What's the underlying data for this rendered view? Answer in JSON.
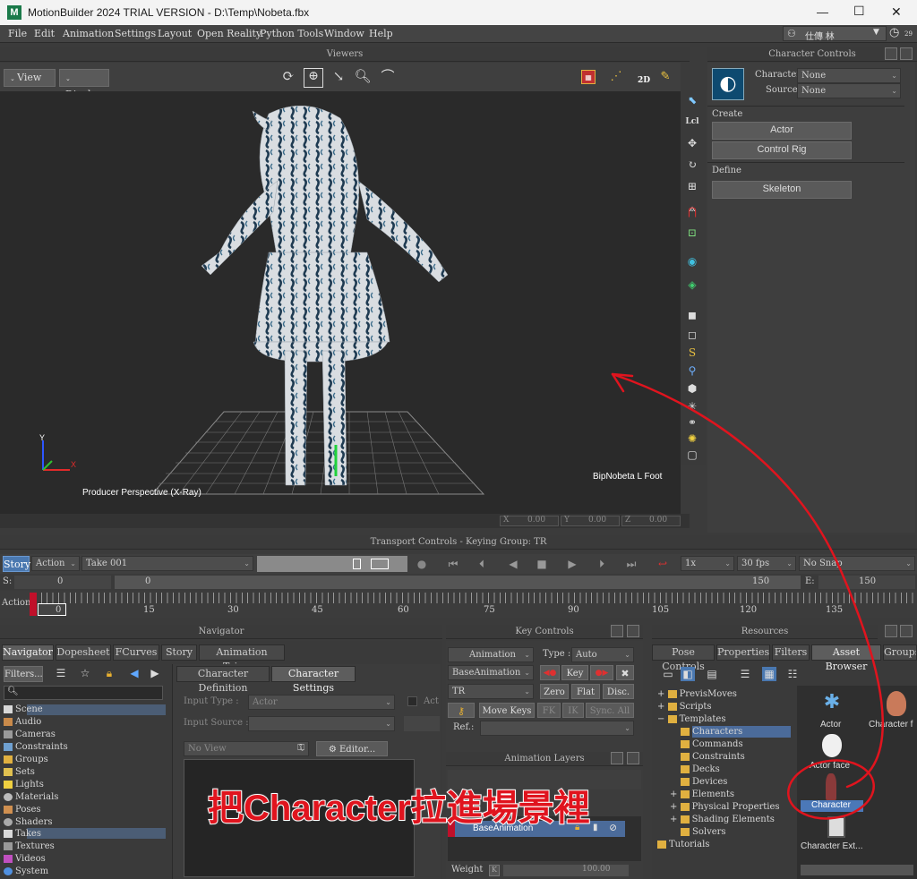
{
  "window": {
    "title": "MotionBuilder 2024 TRIAL VERSION - D:\\Temp\\Nobeta.fbx",
    "minimize": "—",
    "maximize": "☐",
    "close": "✕",
    "user": "仕傳 林",
    "clock_badge": "29"
  },
  "menu": [
    "File",
    "Edit",
    "Animation",
    "Settings",
    "Layout",
    "Open Reality",
    "Python Tools",
    "Window",
    "Help"
  ],
  "viewer": {
    "title": "Viewers",
    "view_btn": "View",
    "display_btn": "Display",
    "camera_label": "Producer Perspective (X-Ray)",
    "selection_label": "BipNobeta L Foot",
    "axis_x": "X",
    "axis_y": "Y",
    "coord_x_label": "X",
    "coord_x": "0.00",
    "coord_y_label": "Y",
    "coord_y": "0.00",
    "coord_z_label": "Z",
    "coord_z": "0.00",
    "toolbar_2d": "2D"
  },
  "character_controls": {
    "title": "Character Controls",
    "character_label": "Character:",
    "character_value": "None",
    "source_label": "Source:",
    "source_value": "None",
    "create_label": "Create",
    "actor_btn": "Actor",
    "control_rig_btn": "Control Rig",
    "define_label": "Define",
    "skeleton_btn": "Skeleton"
  },
  "transport": {
    "title": "Transport Controls  -  Keying Group: TR",
    "story_btn": "Story",
    "action_mode": "Action",
    "take": "Take 001",
    "speed": "1x",
    "fps": "30 fps",
    "snap": "No Snap",
    "start_label": "S:",
    "start_value": "0",
    "current_value": "0",
    "end_mark": "150",
    "end_label": "E:",
    "end_value": "150",
    "track_label": "Action",
    "ruler_current": "0",
    "ruler_ticks": [
      "15",
      "30",
      "45",
      "60",
      "75",
      "90",
      "105",
      "120",
      "135"
    ]
  },
  "navigator": {
    "title": "Navigator",
    "tabs": [
      "Navigator",
      "Dopesheet",
      "FCurves",
      "Story",
      "Animation Trigger"
    ],
    "filters_btn": "Filters...",
    "tree": [
      "Scene",
      "Audio",
      "Cameras",
      "Constraints",
      "Groups",
      "Sets",
      "Lights",
      "Materials",
      "Poses",
      "Shaders",
      "Takes",
      "Textures",
      "Videos",
      "System"
    ],
    "subtabs": [
      "Character Definition",
      "Character Settings"
    ],
    "input_type_label": "Input Type :",
    "input_type_value": "Actor",
    "input_source_label": "Input Source :",
    "act_label": "Act",
    "no_view": "No View",
    "editor_btn": "Editor..."
  },
  "key_controls": {
    "title": "Key Controls",
    "animation_dd": "Animation",
    "type_label": "Type :",
    "type_value": "Auto",
    "base_animation_dd": "BaseAnimation",
    "key_btn": "Key",
    "tr_dd": "TR",
    "zero_btn": "Zero",
    "flat_btn": "Flat",
    "disc_btn": "Disc.",
    "move_keys_btn": "Move Keys",
    "fk_btn": "FK",
    "ik_btn": "IK",
    "sync_btn": "Sync. All",
    "ref_label": "Ref.:",
    "layers_title": "Animation Layers",
    "layer_name": "BaseAnimation",
    "weight_label": "Weight",
    "weight_k": "K",
    "weight_value": "100.00"
  },
  "resources": {
    "title": "Resources",
    "tabs": [
      "Pose Controls",
      "Properties",
      "Filters",
      "Asset Browser",
      "Groups"
    ],
    "tree": [
      "PrevisMoves",
      "Scripts",
      "Templates",
      "Characters",
      "Commands",
      "Constraints",
      "Decks",
      "Devices",
      "Elements",
      "Physical Properties",
      "Shading Elements",
      "Solvers",
      "Tutorials"
    ],
    "assets": [
      "Actor",
      "Character f",
      "Actor face",
      "Character",
      "Character Ext..."
    ]
  },
  "annotation": {
    "text": "把Character拉進場景裡",
    "color": "#e0141e"
  }
}
